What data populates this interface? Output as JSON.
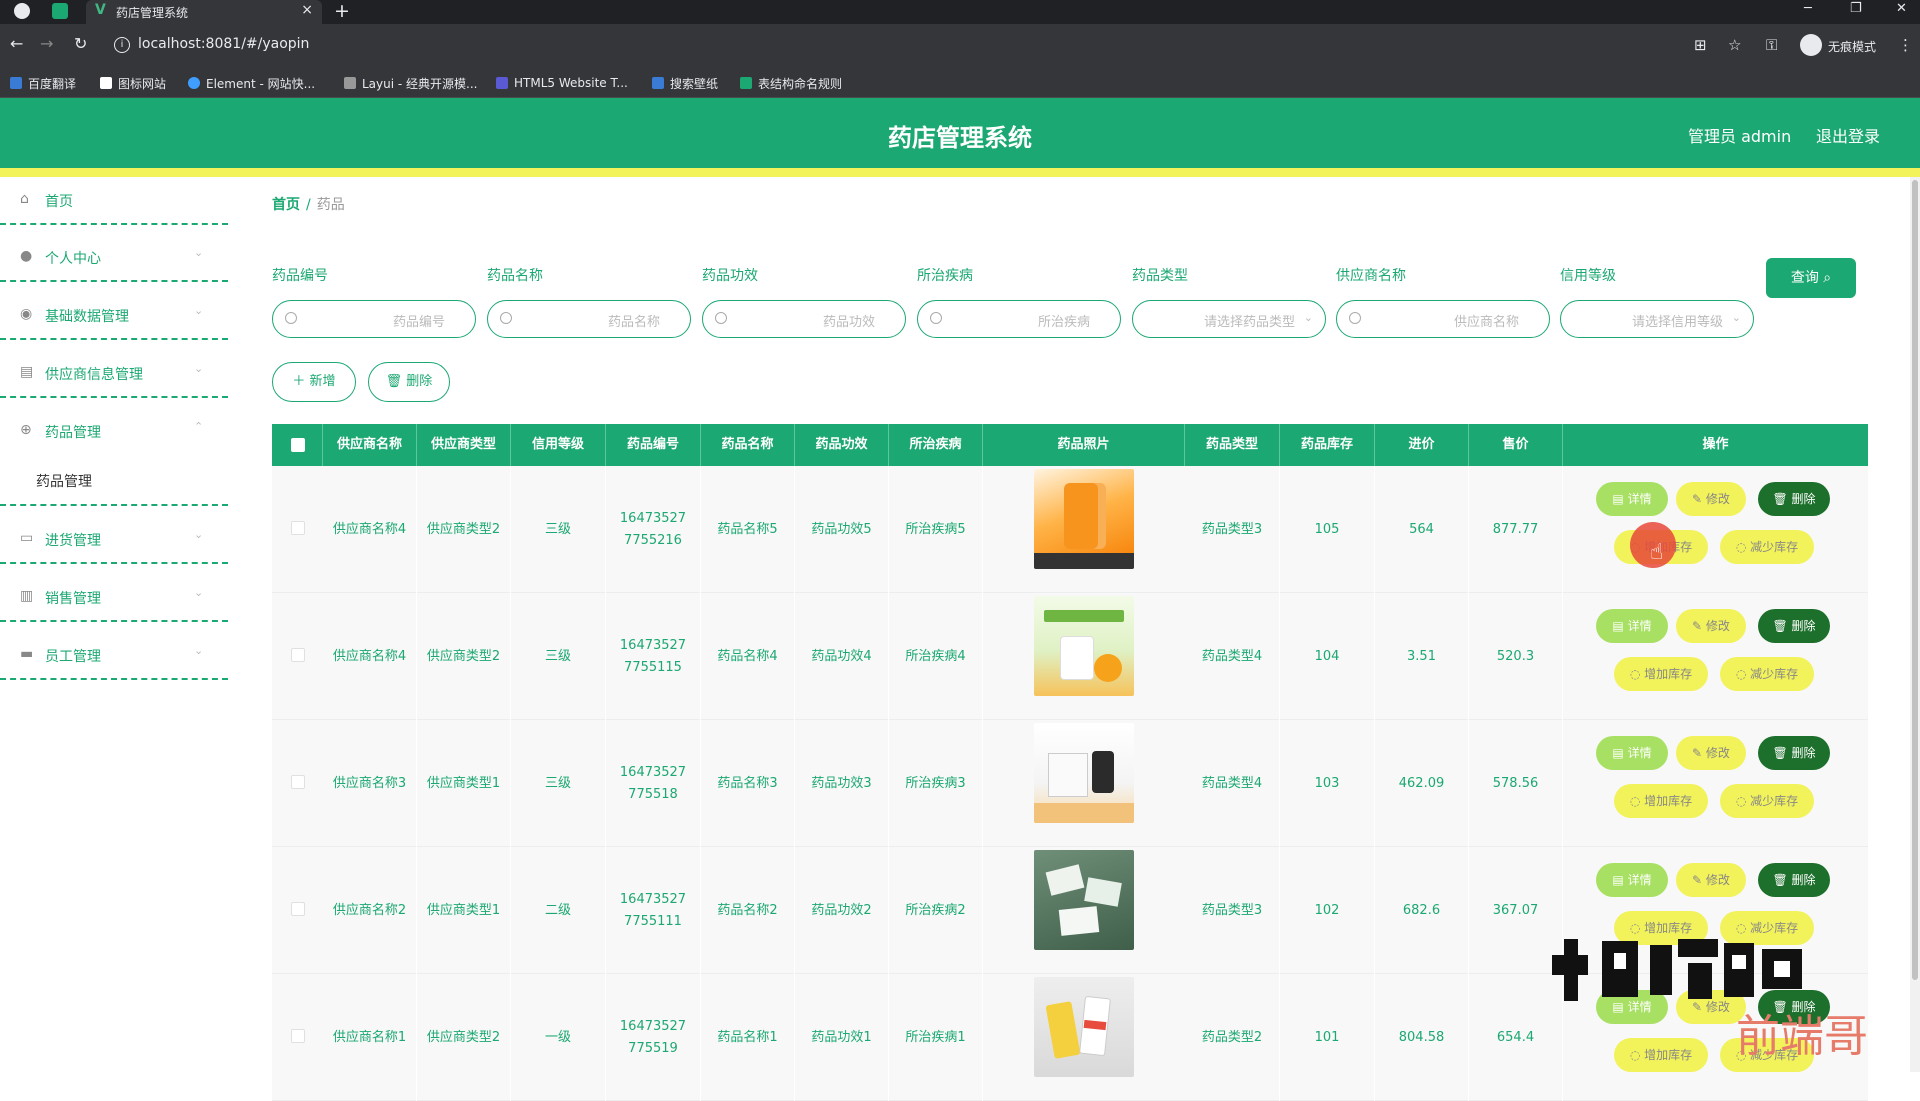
{
  "browser": {
    "tab_title": "药店管理系统",
    "tab_close": "×",
    "new_tab": "+",
    "url": "localhost:8081/#/yaopin",
    "profile_label": "无痕模式",
    "bookmarks": [
      "百度翻译",
      "图标网站",
      "Element - 网站快...",
      "Layui - 经典开源模...",
      "HTML5 Website T...",
      "搜索壁纸",
      "表结构命名规则"
    ]
  },
  "header": {
    "title": "药店管理系统",
    "admin": "管理员 admin",
    "logout": "退出登录"
  },
  "sidebar": {
    "items": [
      {
        "label": "首页",
        "icon": "home-icon"
      },
      {
        "label": "个人中心",
        "icon": "user-icon"
      },
      {
        "label": "基础数据管理",
        "icon": "location-icon"
      },
      {
        "label": "供应商信息管理",
        "icon": "printer-icon"
      },
      {
        "label": "药品管理",
        "icon": "compass-icon"
      },
      {
        "label": "进货管理",
        "icon": "chat-icon"
      },
      {
        "label": "销售管理",
        "icon": "trash-icon"
      },
      {
        "label": "员工管理",
        "icon": "truck-icon"
      }
    ],
    "sub_item": "药品管理"
  },
  "breadcrumb": {
    "home": "首页",
    "separator": "/",
    "current": "药品"
  },
  "filters": [
    {
      "label": "药品编号",
      "placeholder": "药品编号"
    },
    {
      "label": "药品名称",
      "placeholder": "药品名称"
    },
    {
      "label": "药品功效",
      "placeholder": "药品功效"
    },
    {
      "label": "所治疾病",
      "placeholder": "所治疾病"
    },
    {
      "label": "药品类型",
      "placeholder": "请选择药品类型"
    },
    {
      "label": "供应商名称",
      "placeholder": "供应商名称"
    },
    {
      "label": "信用等级",
      "placeholder": "请选择信用等级"
    }
  ],
  "buttons": {
    "query": "查询 ⌕",
    "add": "＋ 新增",
    "delete": "🗑 删除"
  },
  "table": {
    "columns": [
      "供应商名称",
      "供应商类型",
      "信用等级",
      "药品编号",
      "药品名称",
      "药品功效",
      "所治疾病",
      "药品照片",
      "药品类型",
      "药品库存",
      "进价",
      "售价",
      "操作"
    ],
    "rows": [
      {
        "supplier": "供应商名称4",
        "supplier_type": "供应商类型2",
        "credit": "三级",
        "code": "16473527 7755216",
        "name": "药品名称5",
        "effect": "药品功效5",
        "disease": "所治疾病5",
        "photo": "orange-bottle",
        "type": "药品类型3",
        "stock": "105",
        "cost": "564",
        "price": "877.77"
      },
      {
        "supplier": "供应商名称4",
        "supplier_type": "供应商类型2",
        "credit": "三级",
        "code": "16473527 7755115",
        "name": "药品名称4",
        "effect": "药品功效4",
        "disease": "所治疾病4",
        "photo": "vitamin-c",
        "type": "药品类型4",
        "stock": "104",
        "cost": "3.51",
        "price": "520.3"
      },
      {
        "supplier": "供应商名称3",
        "supplier_type": "供应商类型1",
        "credit": "三级",
        "code": "16473527 775518",
        "name": "药品名称3",
        "effect": "药品功效3",
        "disease": "所治疾病3",
        "photo": "white-box",
        "type": "药品类型4",
        "stock": "103",
        "cost": "462.09",
        "price": "578.56"
      },
      {
        "supplier": "供应商名称2",
        "supplier_type": "供应商类型1",
        "credit": "二级",
        "code": "16473527 7755111",
        "name": "药品名称2",
        "effect": "药品功效2",
        "disease": "所治疾病2",
        "photo": "green-cards",
        "type": "药品类型3",
        "stock": "102",
        "cost": "682.6",
        "price": "367.07"
      },
      {
        "supplier": "供应商名称1",
        "supplier_type": "供应商类型2",
        "credit": "一级",
        "code": "16473527 775519",
        "name": "药品名称1",
        "effect": "药品功效1",
        "disease": "所治疾病1",
        "photo": "yellow-packs",
        "type": "药品类型2",
        "stock": "101",
        "cost": "804.58",
        "price": "654.4"
      }
    ],
    "ops": {
      "detail": "详情",
      "edit": "修改",
      "delete": "删除",
      "add_stock": "增加库存",
      "reduce_stock": "减少库存"
    }
  },
  "watermark": "前端哥",
  "colors": {
    "primary": "#1ca872",
    "accent_yellow": "#f2f25a",
    "detail_green": "#a8e063",
    "delete_dark": "#1d6f2c"
  }
}
